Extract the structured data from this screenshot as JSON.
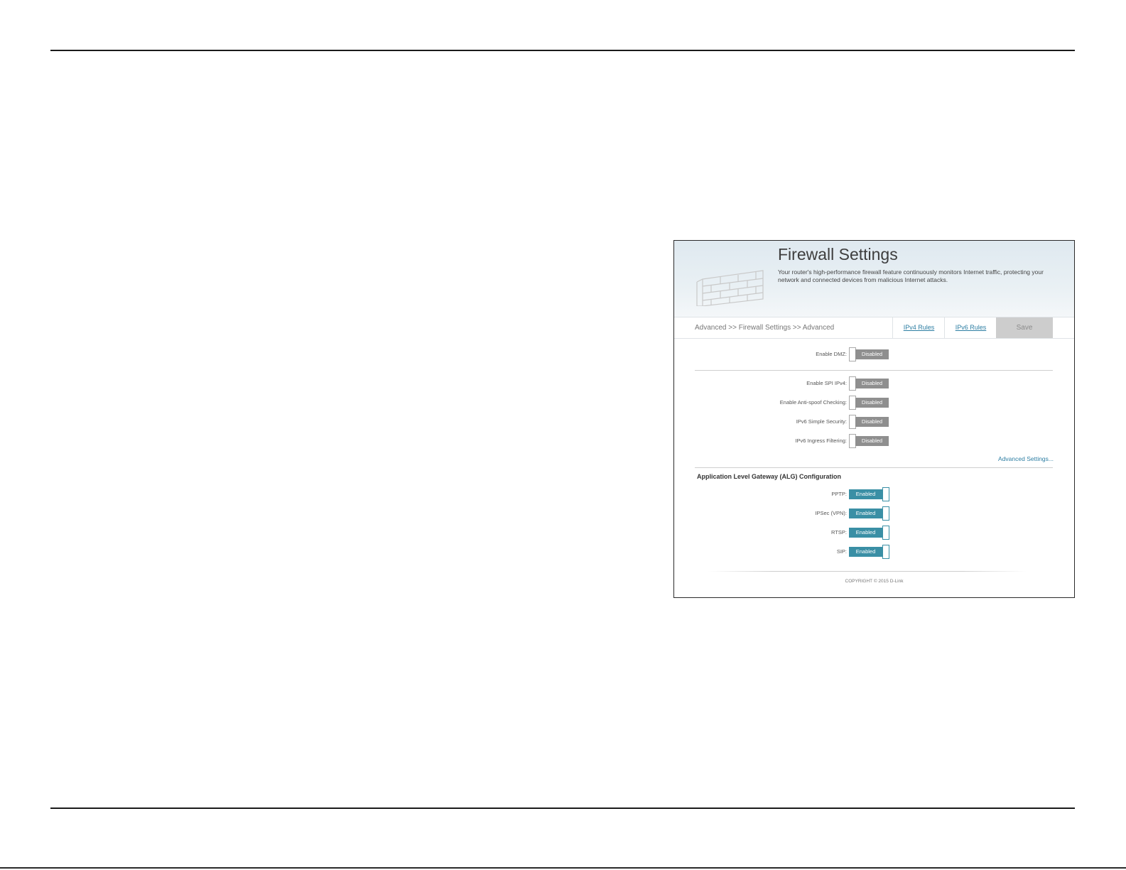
{
  "header": {
    "title": "Firewall Settings",
    "description": "Your router's high-performance firewall feature continuously monitors Internet traffic, protecting your network and connected devices from malicious Internet attacks."
  },
  "nav": {
    "breadcrumb": "Advanced >> Firewall Settings >> Advanced",
    "ipv4_rules": "IPv4 Rules",
    "ipv6_rules": "IPv6 Rules",
    "save": "Save"
  },
  "settings": {
    "dmz": {
      "label": "Enable DMZ:",
      "state": "Disabled"
    },
    "spi_ipv4": {
      "label": "Enable SPI IPv4:",
      "state": "Disabled"
    },
    "anti_spoof": {
      "label": "Enable Anti-spoof Checking:",
      "state": "Disabled"
    },
    "ipv6_simple_security": {
      "label": "IPv6 Simple Security:",
      "state": "Disabled"
    },
    "ipv6_ingress_filtering": {
      "label": "IPv6 Ingress Filtering:",
      "state": "Disabled"
    }
  },
  "advanced_link": "Advanced Settings...",
  "alg": {
    "heading": "Application Level Gateway (ALG) Configuration",
    "pptp": {
      "label": "PPTP:",
      "state": "Enabled"
    },
    "ipsec": {
      "label": "IPSec (VPN):",
      "state": "Enabled"
    },
    "rtsp": {
      "label": "RTSP:",
      "state": "Enabled"
    },
    "sip": {
      "label": "SIP:",
      "state": "Enabled"
    }
  },
  "footer": {
    "copyright": "COPYRIGHT © 2015 D-Link"
  },
  "colors": {
    "accent": "#3a8fa5",
    "disabled_toggle": "#8f8f8f",
    "link": "#2d7ea3"
  },
  "icons": {
    "banner": "brick-wall-icon"
  }
}
